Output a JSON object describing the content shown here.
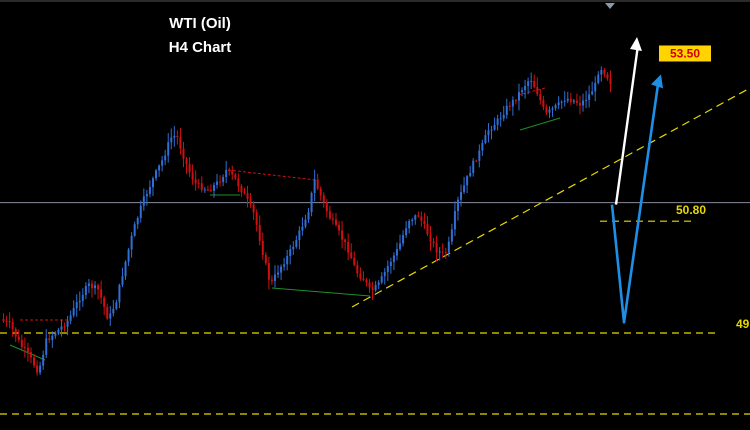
{
  "chart_data": {
    "type": "candlestick",
    "title": "WTI (Oil)",
    "subtitle": "H4 Chart",
    "price_range": [
      47.6,
      54.2
    ],
    "bar_count": 200,
    "levels": [
      {
        "label": "53.50",
        "price": 53.5,
        "style": "tag"
      },
      {
        "label": "50.80",
        "price": 50.8,
        "style": "dashed"
      },
      {
        "label": "49",
        "price": 49.0,
        "style": "dashed"
      }
    ],
    "current_price": 51.1,
    "colors": {
      "background": "#000000",
      "bull_candle": "#2f6fd6",
      "bear_candle": "#d01010",
      "level_line": "#e6d800",
      "trendline": "#e6d800",
      "price_tag": "#ffd400",
      "price_tag_text": "#d00000",
      "arrow_white": "#ffffff",
      "arrow_blue": "#1e8fe6",
      "current_price_line": "#8a8a9a"
    },
    "scenarios": [
      {
        "name": "white-arrow",
        "path": [
          51.1,
          53.7
        ]
      },
      {
        "name": "blue-arrow",
        "path": [
          51.1,
          49.3,
          53.1
        ]
      }
    ]
  }
}
